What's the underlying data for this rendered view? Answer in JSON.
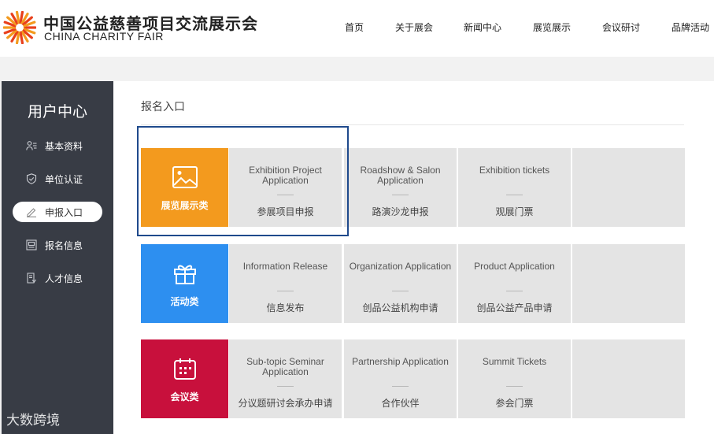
{
  "brand": {
    "name_cn": "中国公益慈善项目交流展示会",
    "name_en": "CHINA CHARITY FAIR",
    "logo_icon": "sunburst-logo-icon",
    "logo_colors": [
      "#e8401c",
      "#f39a1e"
    ]
  },
  "nav": [
    {
      "label": "首页"
    },
    {
      "label": "关于展会"
    },
    {
      "label": "新闻中心"
    },
    {
      "label": "展览展示"
    },
    {
      "label": "会议研讨"
    },
    {
      "label": "品牌活动"
    }
  ],
  "sidebar": {
    "title": "用户中心",
    "items": [
      {
        "label": "基本资料",
        "icon": "user-list-icon",
        "active": false
      },
      {
        "label": "单位认证",
        "icon": "shield-check-icon",
        "active": false
      },
      {
        "label": "申报入口",
        "icon": "pen-edit-icon",
        "active": true
      },
      {
        "label": "报名信息",
        "icon": "form-icon",
        "active": false
      },
      {
        "label": "人才信息",
        "icon": "document-icon",
        "active": false
      }
    ]
  },
  "main": {
    "title": "报名入口",
    "rows": [
      {
        "category": {
          "label": "展览展示类",
          "icon": "image-icon",
          "color": "#f39a1e"
        },
        "cards": [
          {
            "en": "Exhibition Project Application",
            "cn": "参展项目申报"
          },
          {
            "en": "Roadshow & Salon Application",
            "cn": "路演沙龙申报"
          },
          {
            "en": "Exhibition tickets",
            "cn": "观展门票"
          },
          {
            "en": "",
            "cn": ""
          }
        ]
      },
      {
        "category": {
          "label": "活动类",
          "icon": "gift-icon",
          "color": "#2d8ff0"
        },
        "cards": [
          {
            "en": "Information Release",
            "cn": "信息发布"
          },
          {
            "en": "Organization Application",
            "cn": "创品公益机构申请"
          },
          {
            "en": "Product Application",
            "cn": "创品公益产品申请"
          },
          {
            "en": "",
            "cn": ""
          }
        ]
      },
      {
        "category": {
          "label": "会议类",
          "icon": "calendar-icon",
          "color": "#c8103c"
        },
        "cards": [
          {
            "en": "Sub-topic Seminar Application",
            "cn": "分议题研讨会承办申请"
          },
          {
            "en": "Partnership Application",
            "cn": "合作伙伴"
          },
          {
            "en": "Summit Tickets",
            "cn": "参会门票"
          },
          {
            "en": "",
            "cn": ""
          }
        ]
      }
    ]
  },
  "watermark": "大数跨境"
}
